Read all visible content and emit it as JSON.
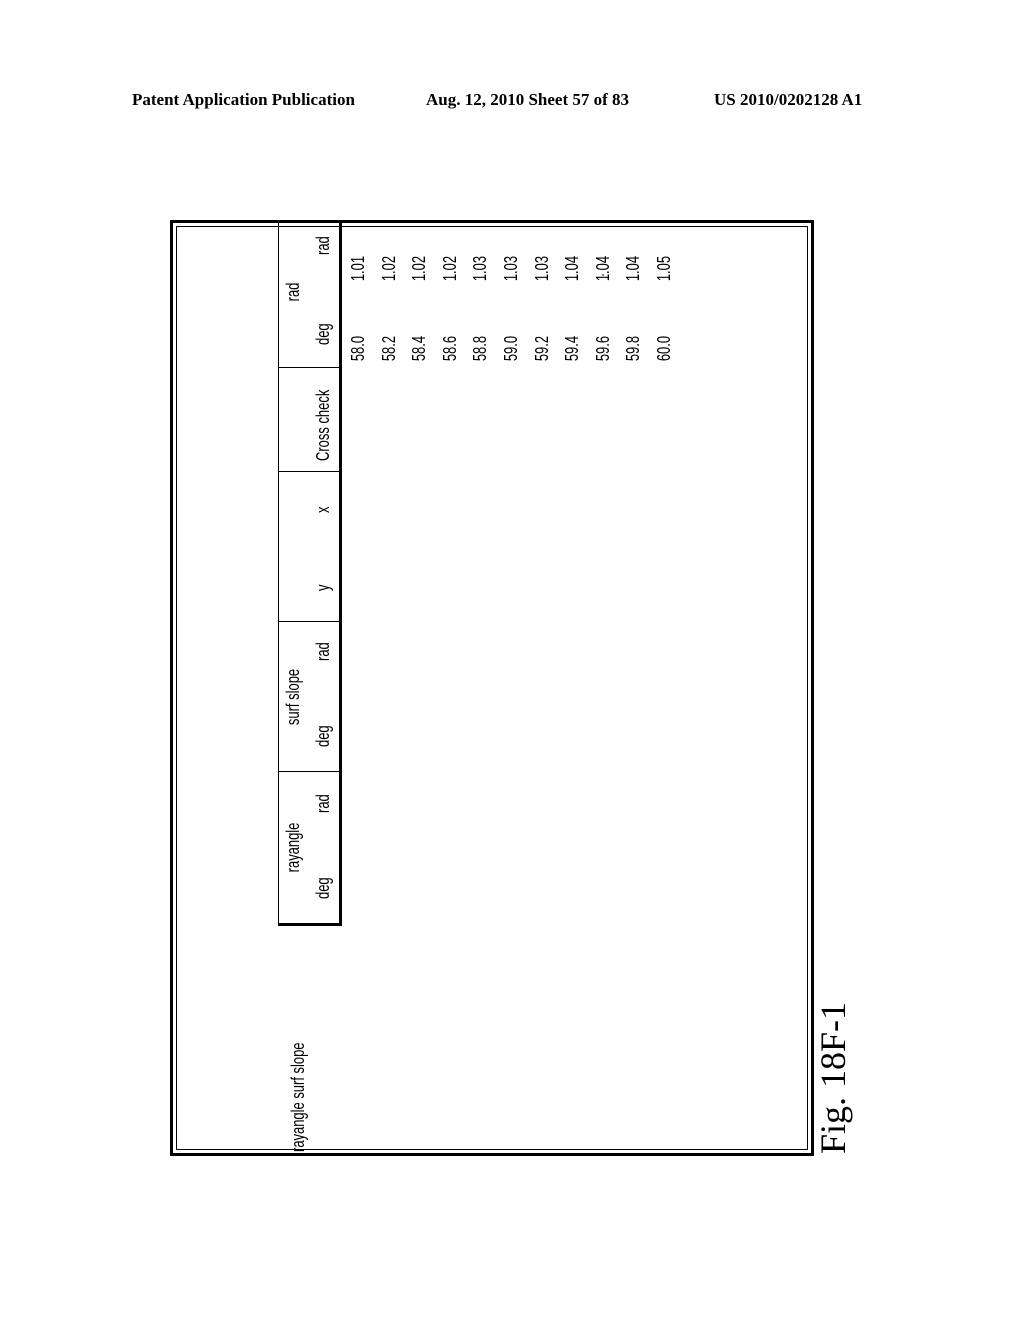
{
  "header": {
    "left": "Patent Application Publication",
    "middle": "Aug. 12, 2010  Sheet 57 of 83",
    "right": "US 2010/0202128 A1"
  },
  "figure": {
    "caption": "Fig. 18F-1",
    "side_note": "rayangle  surf slope",
    "table": {
      "groups": [
        {
          "title": "rayangle",
          "subs": [
            "deg",
            "rad"
          ]
        },
        {
          "title": "surf slope",
          "subs": [
            "deg",
            "rad"
          ]
        },
        {
          "title": "",
          "subs": [
            "y",
            "x"
          ]
        },
        {
          "title": "Cross check",
          "subs": []
        },
        {
          "title": "rad",
          "subs": [
            "deg",
            "rad"
          ]
        }
      ],
      "columns": {
        "deg": [
          "58.0",
          "58.2",
          "58.4",
          "58.6",
          "58.8",
          "59.0",
          "59.2",
          "59.4",
          "59.6",
          "59.8",
          "60.0"
        ],
        "rad": [
          "1.01",
          "1.02",
          "1.02",
          "1.02",
          "1.03",
          "1.03",
          "1.03",
          "1.04",
          "1.04",
          "1.04",
          "1.05"
        ]
      }
    }
  }
}
